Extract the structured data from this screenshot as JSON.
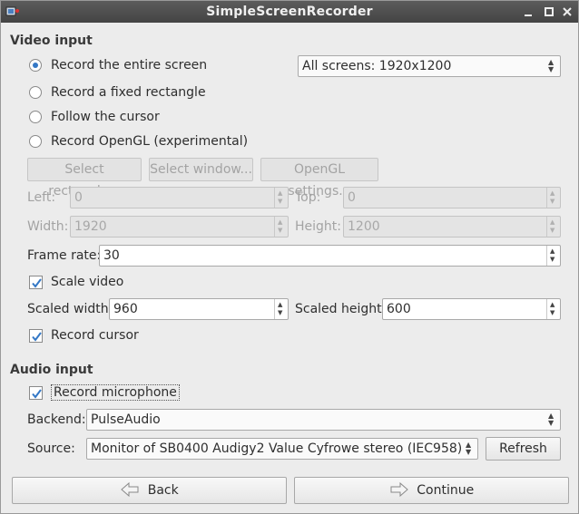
{
  "window": {
    "title": "SimpleScreenRecorder"
  },
  "video": {
    "section_title": "Video input",
    "options": [
      {
        "label": "Record the entire screen",
        "checked": true
      },
      {
        "label": "Record a fixed rectangle",
        "checked": false
      },
      {
        "label": "Follow the cursor",
        "checked": false
      },
      {
        "label": "Record OpenGL (experimental)",
        "checked": false
      }
    ],
    "screen_select": "All screens: 1920x1200",
    "buttons": {
      "select_rectangle": "Select rectangle...",
      "select_window": "Select window...",
      "opengl_settings": "OpenGL settings..."
    },
    "left_label": "Left:",
    "left_value": "0",
    "top_label": "Top:",
    "top_value": "0",
    "width_label": "Width:",
    "width_value": "1920",
    "height_label": "Height:",
    "height_value": "1200",
    "frame_rate_label": "Frame rate:",
    "frame_rate_value": "30",
    "scale_video_label": "Scale video",
    "scale_video_checked": true,
    "scaled_width_label": "Scaled width:",
    "scaled_width_value": "960",
    "scaled_height_label": "Scaled height:",
    "scaled_height_value": "600",
    "record_cursor_label": "Record cursor",
    "record_cursor_checked": true
  },
  "audio": {
    "section_title": "Audio input",
    "record_microphone_label": "Record microphone",
    "record_microphone_checked": true,
    "backend_label": "Backend:",
    "backend_value": "PulseAudio",
    "source_label": "Source:",
    "source_value": "Monitor of SB0400 Audigy2 Value Cyfrowe stereo (IEC958)",
    "refresh_label": "Refresh"
  },
  "footer": {
    "back_label": "Back",
    "continue_label": "Continue"
  },
  "colors": {
    "titlebar": "#4c4c4c",
    "accent": "#3478c6",
    "window_bg": "#ececec"
  }
}
